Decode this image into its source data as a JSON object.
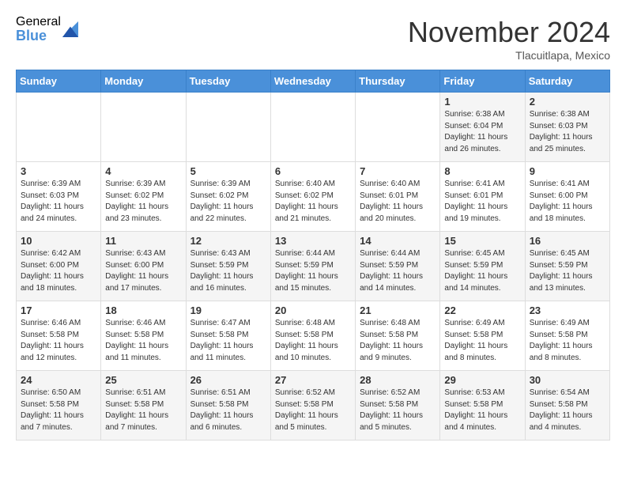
{
  "logo": {
    "general": "General",
    "blue": "Blue"
  },
  "title": "November 2024",
  "location": "Tlacuitlapa, Mexico",
  "header_days": [
    "Sunday",
    "Monday",
    "Tuesday",
    "Wednesday",
    "Thursday",
    "Friday",
    "Saturday"
  ],
  "weeks": [
    [
      {
        "day": "",
        "info": ""
      },
      {
        "day": "",
        "info": ""
      },
      {
        "day": "",
        "info": ""
      },
      {
        "day": "",
        "info": ""
      },
      {
        "day": "",
        "info": ""
      },
      {
        "day": "1",
        "info": "Sunrise: 6:38 AM\nSunset: 6:04 PM\nDaylight: 11 hours and 26 minutes."
      },
      {
        "day": "2",
        "info": "Sunrise: 6:38 AM\nSunset: 6:03 PM\nDaylight: 11 hours and 25 minutes."
      }
    ],
    [
      {
        "day": "3",
        "info": "Sunrise: 6:39 AM\nSunset: 6:03 PM\nDaylight: 11 hours and 24 minutes."
      },
      {
        "day": "4",
        "info": "Sunrise: 6:39 AM\nSunset: 6:02 PM\nDaylight: 11 hours and 23 minutes."
      },
      {
        "day": "5",
        "info": "Sunrise: 6:39 AM\nSunset: 6:02 PM\nDaylight: 11 hours and 22 minutes."
      },
      {
        "day": "6",
        "info": "Sunrise: 6:40 AM\nSunset: 6:02 PM\nDaylight: 11 hours and 21 minutes."
      },
      {
        "day": "7",
        "info": "Sunrise: 6:40 AM\nSunset: 6:01 PM\nDaylight: 11 hours and 20 minutes."
      },
      {
        "day": "8",
        "info": "Sunrise: 6:41 AM\nSunset: 6:01 PM\nDaylight: 11 hours and 19 minutes."
      },
      {
        "day": "9",
        "info": "Sunrise: 6:41 AM\nSunset: 6:00 PM\nDaylight: 11 hours and 18 minutes."
      }
    ],
    [
      {
        "day": "10",
        "info": "Sunrise: 6:42 AM\nSunset: 6:00 PM\nDaylight: 11 hours and 18 minutes."
      },
      {
        "day": "11",
        "info": "Sunrise: 6:43 AM\nSunset: 6:00 PM\nDaylight: 11 hours and 17 minutes."
      },
      {
        "day": "12",
        "info": "Sunrise: 6:43 AM\nSunset: 5:59 PM\nDaylight: 11 hours and 16 minutes."
      },
      {
        "day": "13",
        "info": "Sunrise: 6:44 AM\nSunset: 5:59 PM\nDaylight: 11 hours and 15 minutes."
      },
      {
        "day": "14",
        "info": "Sunrise: 6:44 AM\nSunset: 5:59 PM\nDaylight: 11 hours and 14 minutes."
      },
      {
        "day": "15",
        "info": "Sunrise: 6:45 AM\nSunset: 5:59 PM\nDaylight: 11 hours and 14 minutes."
      },
      {
        "day": "16",
        "info": "Sunrise: 6:45 AM\nSunset: 5:59 PM\nDaylight: 11 hours and 13 minutes."
      }
    ],
    [
      {
        "day": "17",
        "info": "Sunrise: 6:46 AM\nSunset: 5:58 PM\nDaylight: 11 hours and 12 minutes."
      },
      {
        "day": "18",
        "info": "Sunrise: 6:46 AM\nSunset: 5:58 PM\nDaylight: 11 hours and 11 minutes."
      },
      {
        "day": "19",
        "info": "Sunrise: 6:47 AM\nSunset: 5:58 PM\nDaylight: 11 hours and 11 minutes."
      },
      {
        "day": "20",
        "info": "Sunrise: 6:48 AM\nSunset: 5:58 PM\nDaylight: 11 hours and 10 minutes."
      },
      {
        "day": "21",
        "info": "Sunrise: 6:48 AM\nSunset: 5:58 PM\nDaylight: 11 hours and 9 minutes."
      },
      {
        "day": "22",
        "info": "Sunrise: 6:49 AM\nSunset: 5:58 PM\nDaylight: 11 hours and 8 minutes."
      },
      {
        "day": "23",
        "info": "Sunrise: 6:49 AM\nSunset: 5:58 PM\nDaylight: 11 hours and 8 minutes."
      }
    ],
    [
      {
        "day": "24",
        "info": "Sunrise: 6:50 AM\nSunset: 5:58 PM\nDaylight: 11 hours and 7 minutes."
      },
      {
        "day": "25",
        "info": "Sunrise: 6:51 AM\nSunset: 5:58 PM\nDaylight: 11 hours and 7 minutes."
      },
      {
        "day": "26",
        "info": "Sunrise: 6:51 AM\nSunset: 5:58 PM\nDaylight: 11 hours and 6 minutes."
      },
      {
        "day": "27",
        "info": "Sunrise: 6:52 AM\nSunset: 5:58 PM\nDaylight: 11 hours and 5 minutes."
      },
      {
        "day": "28",
        "info": "Sunrise: 6:52 AM\nSunset: 5:58 PM\nDaylight: 11 hours and 5 minutes."
      },
      {
        "day": "29",
        "info": "Sunrise: 6:53 AM\nSunset: 5:58 PM\nDaylight: 11 hours and 4 minutes."
      },
      {
        "day": "30",
        "info": "Sunrise: 6:54 AM\nSunset: 5:58 PM\nDaylight: 11 hours and 4 minutes."
      }
    ]
  ]
}
